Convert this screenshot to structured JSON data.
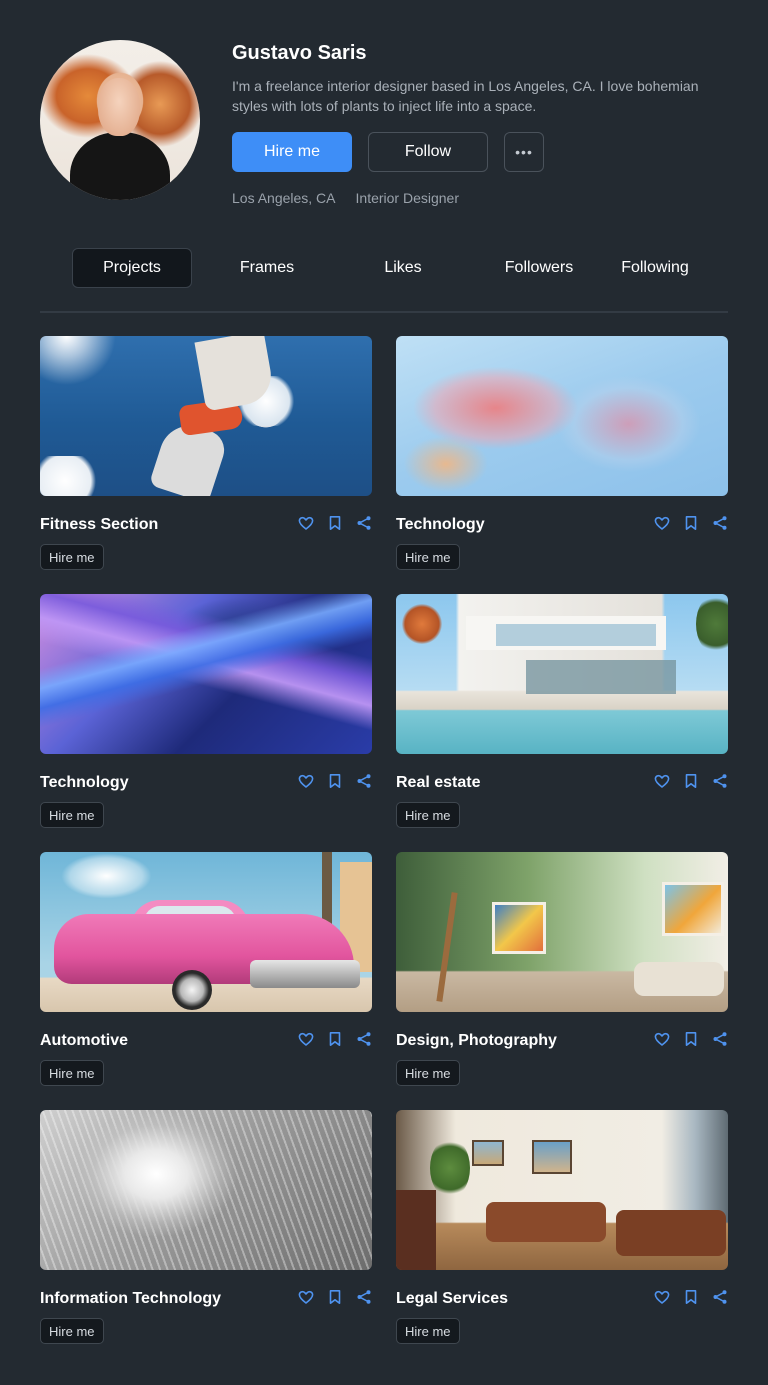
{
  "profile": {
    "name": "Gustavo Saris",
    "bio": "I'm a freelance interior designer based in Los Angeles, CA. I love bohemian styles with lots of plants to inject life into a space.",
    "hire_label": "Hire me",
    "follow_label": "Follow",
    "more_label": "•••",
    "location": "Los Angeles, CA",
    "role": "Interior Designer"
  },
  "tabs": [
    {
      "label": "Projects",
      "active": true
    },
    {
      "label": "Frames",
      "active": false
    },
    {
      "label": "Likes",
      "active": false
    },
    {
      "label": "Followers",
      "active": false
    },
    {
      "label": "Following",
      "active": false
    }
  ],
  "cards": [
    {
      "title": "Fitness Section",
      "chip": "Hire me",
      "image": "runner-jumping-sky"
    },
    {
      "title": "Technology",
      "chip": "Hire me",
      "image": "pink-glass-abstract"
    },
    {
      "title": "Technology",
      "chip": "Hire me",
      "image": "blue-purple-waves"
    },
    {
      "title": "Real estate",
      "chip": "Hire me",
      "image": "modern-villa-pool"
    },
    {
      "title": "Automotive",
      "chip": "Hire me",
      "image": "pink-classic-car"
    },
    {
      "title": "Design, Photography",
      "chip": "Hire me",
      "image": "art-studio"
    },
    {
      "title": "Information Technology",
      "chip": "Hire me",
      "image": "silver-cables"
    },
    {
      "title": "Legal Services",
      "chip": "Hire me",
      "image": "office-lounge"
    }
  ],
  "icons": {
    "like": "heart-icon",
    "save": "bookmark-icon",
    "share": "share-icon"
  },
  "colors": {
    "background": "#232a31",
    "accent": "#3e8ef7",
    "icon": "#4f93ef"
  }
}
